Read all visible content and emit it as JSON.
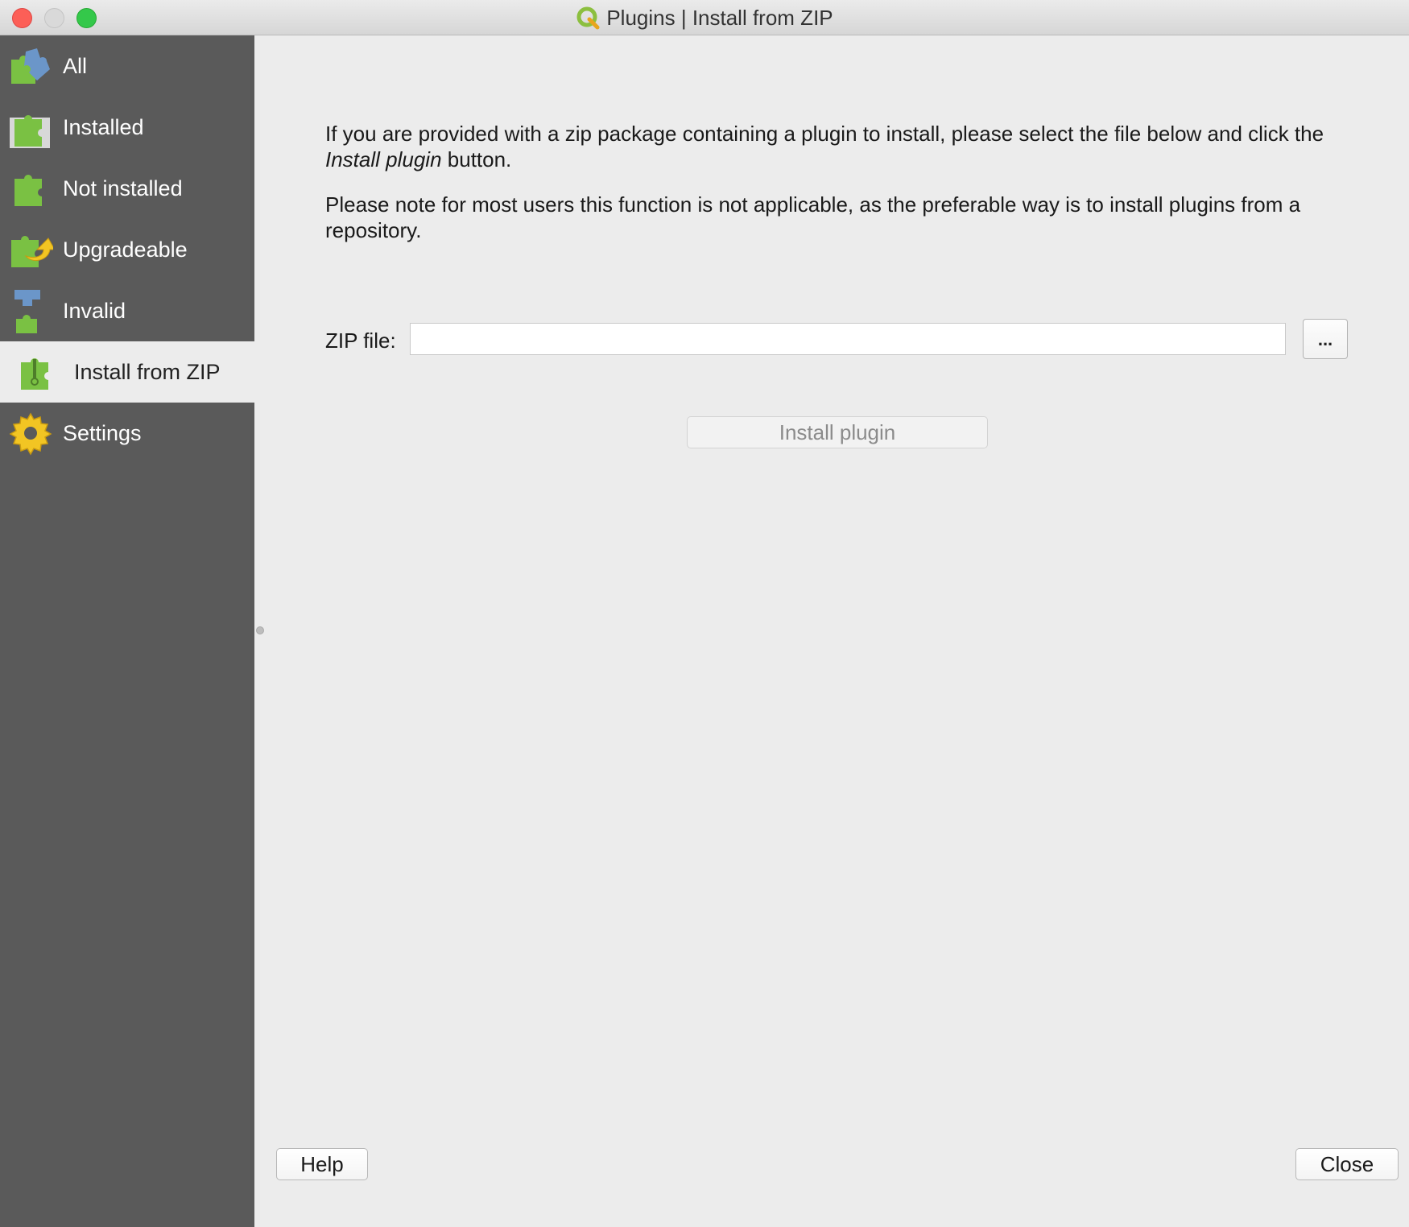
{
  "window": {
    "title": "Plugins | Install from ZIP"
  },
  "sidebar": {
    "items": [
      {
        "label": "All",
        "icon": "puzzle-all-icon"
      },
      {
        "label": "Installed",
        "icon": "puzzle-installed-icon"
      },
      {
        "label": "Not installed",
        "icon": "puzzle-not-installed-icon"
      },
      {
        "label": "Upgradeable",
        "icon": "puzzle-upgrade-icon"
      },
      {
        "label": "Invalid",
        "icon": "puzzle-invalid-icon"
      },
      {
        "label": "Install from ZIP",
        "icon": "puzzle-zip-icon",
        "selected": true
      },
      {
        "label": "Settings",
        "icon": "gear-icon"
      }
    ]
  },
  "main": {
    "intro_part1": "If you are provided with a zip package containing a plugin to install, please select the file below and click the ",
    "intro_emphasis": "Install plugin",
    "intro_part2": " button.",
    "note": "Please note for most users this function is not applicable, as the preferable way is to install plugins from a repository.",
    "zip_label": "ZIP file:",
    "zip_value": "",
    "browse_label": "...",
    "install_label": "Install plugin"
  },
  "footer": {
    "help_label": "Help",
    "close_label": "Close"
  },
  "colors": {
    "sidebar_bg": "#5a5a5a",
    "content_bg": "#ececec",
    "puzzle_green": "#7ac143",
    "puzzle_blue": "#6b96c9",
    "gear_yellow": "#f2c523"
  }
}
